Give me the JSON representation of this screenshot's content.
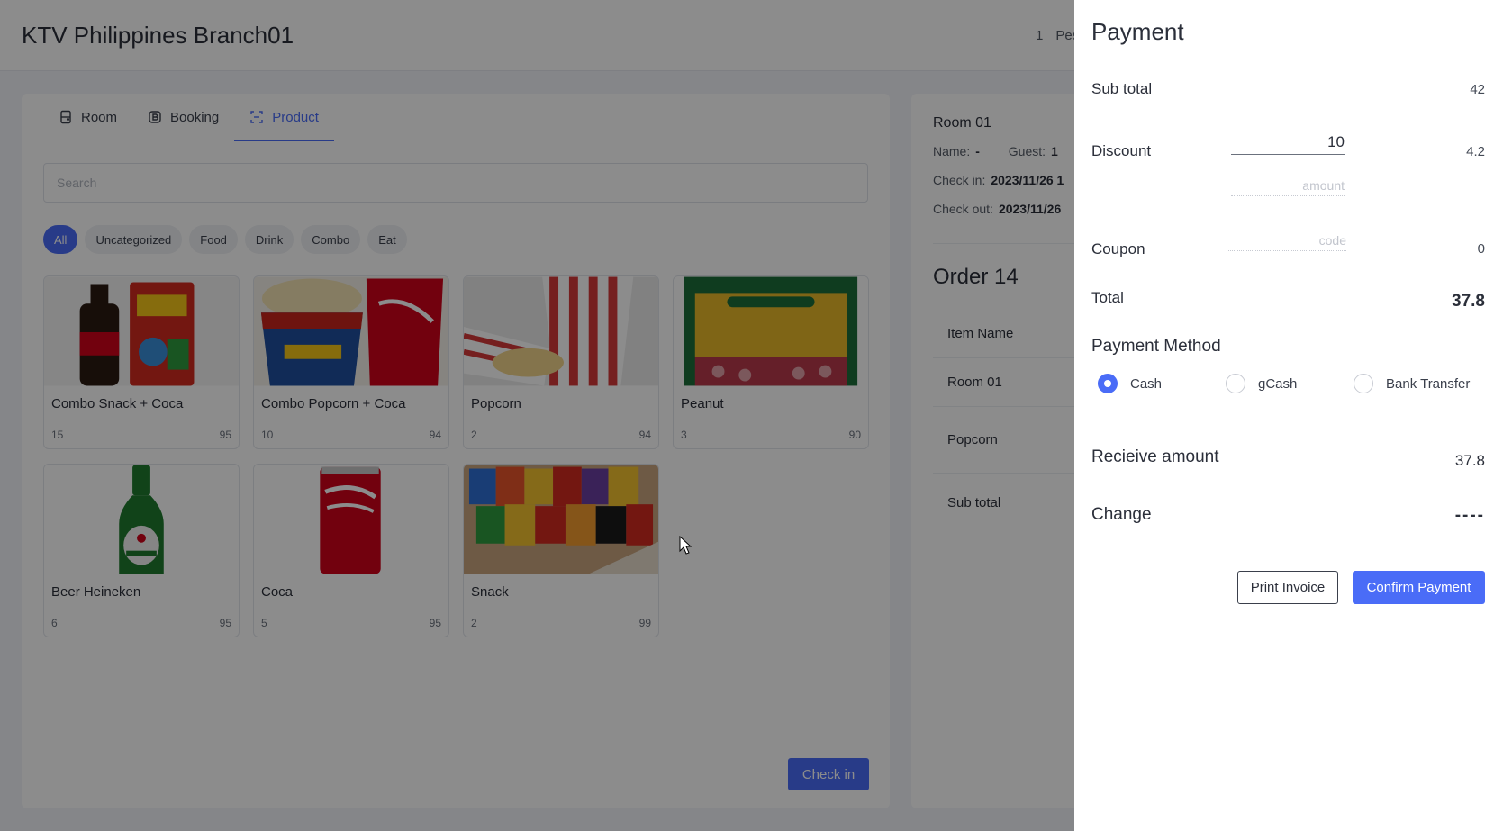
{
  "app": {
    "title": "KTV Philippines Branch01"
  },
  "header": {
    "user_count": "1",
    "user_name": "Pes"
  },
  "tabs": [
    {
      "label": "Room",
      "icon": "room-icon"
    },
    {
      "label": "Booking",
      "icon": "booking-icon"
    },
    {
      "label": "Product",
      "icon": "product-icon"
    }
  ],
  "search": {
    "placeholder": "Search"
  },
  "categories": [
    "All",
    "Uncategorized",
    "Food",
    "Drink",
    "Combo",
    "Eat"
  ],
  "products": [
    {
      "name": "Combo Snack + Coca",
      "qty": "15",
      "stock": "95"
    },
    {
      "name": "Combo Popcorn + Coca",
      "qty": "10",
      "stock": "94"
    },
    {
      "name": "Popcorn",
      "qty": "2",
      "stock": "94"
    },
    {
      "name": "Peanut",
      "qty": "3",
      "stock": "90"
    },
    {
      "name": "Beer Heineken",
      "qty": "6",
      "stock": "95"
    },
    {
      "name": "Coca",
      "qty": "5",
      "stock": "95"
    },
    {
      "name": "Snack",
      "qty": "2",
      "stock": "99"
    }
  ],
  "checkin_button": "Check in",
  "room_panel": {
    "room": "Room 01",
    "name_label": "Name:",
    "name_value": "-",
    "guest_label": "Guest:",
    "guest_value": "1",
    "checkin_label": "Check in:",
    "checkin_value": "2023/11/26 1",
    "checkout_label": "Check out:",
    "checkout_value": "2023/11/26",
    "order_title": "Order 14",
    "col_item_name": "Item Name",
    "rows": [
      "Room 01",
      "Popcorn",
      "Sub total"
    ]
  },
  "payment": {
    "title": "Payment",
    "subtotal_label": "Sub total",
    "subtotal_value": "42",
    "discount_label": "Discount",
    "discount_percent": "10",
    "discount_amount_placeholder": "amount",
    "discount_value": "4.2",
    "coupon_label": "Coupon",
    "coupon_placeholder": "code",
    "coupon_value": "0",
    "total_label": "Total",
    "total_value": "37.8",
    "method_label": "Payment Method",
    "methods": [
      {
        "label": "Cash",
        "checked": true
      },
      {
        "label": "gCash",
        "checked": false
      },
      {
        "label": "Bank Transfer",
        "checked": false
      }
    ],
    "receive_label": "Recieive amount",
    "receive_value": "37.8",
    "change_label": "Change",
    "change_value": "----",
    "print_button": "Print Invoice",
    "confirm_button": "Confirm Payment"
  },
  "colors": {
    "primary": "#4a6cf7",
    "overlay": "rgba(0,0,0,0.45)"
  }
}
